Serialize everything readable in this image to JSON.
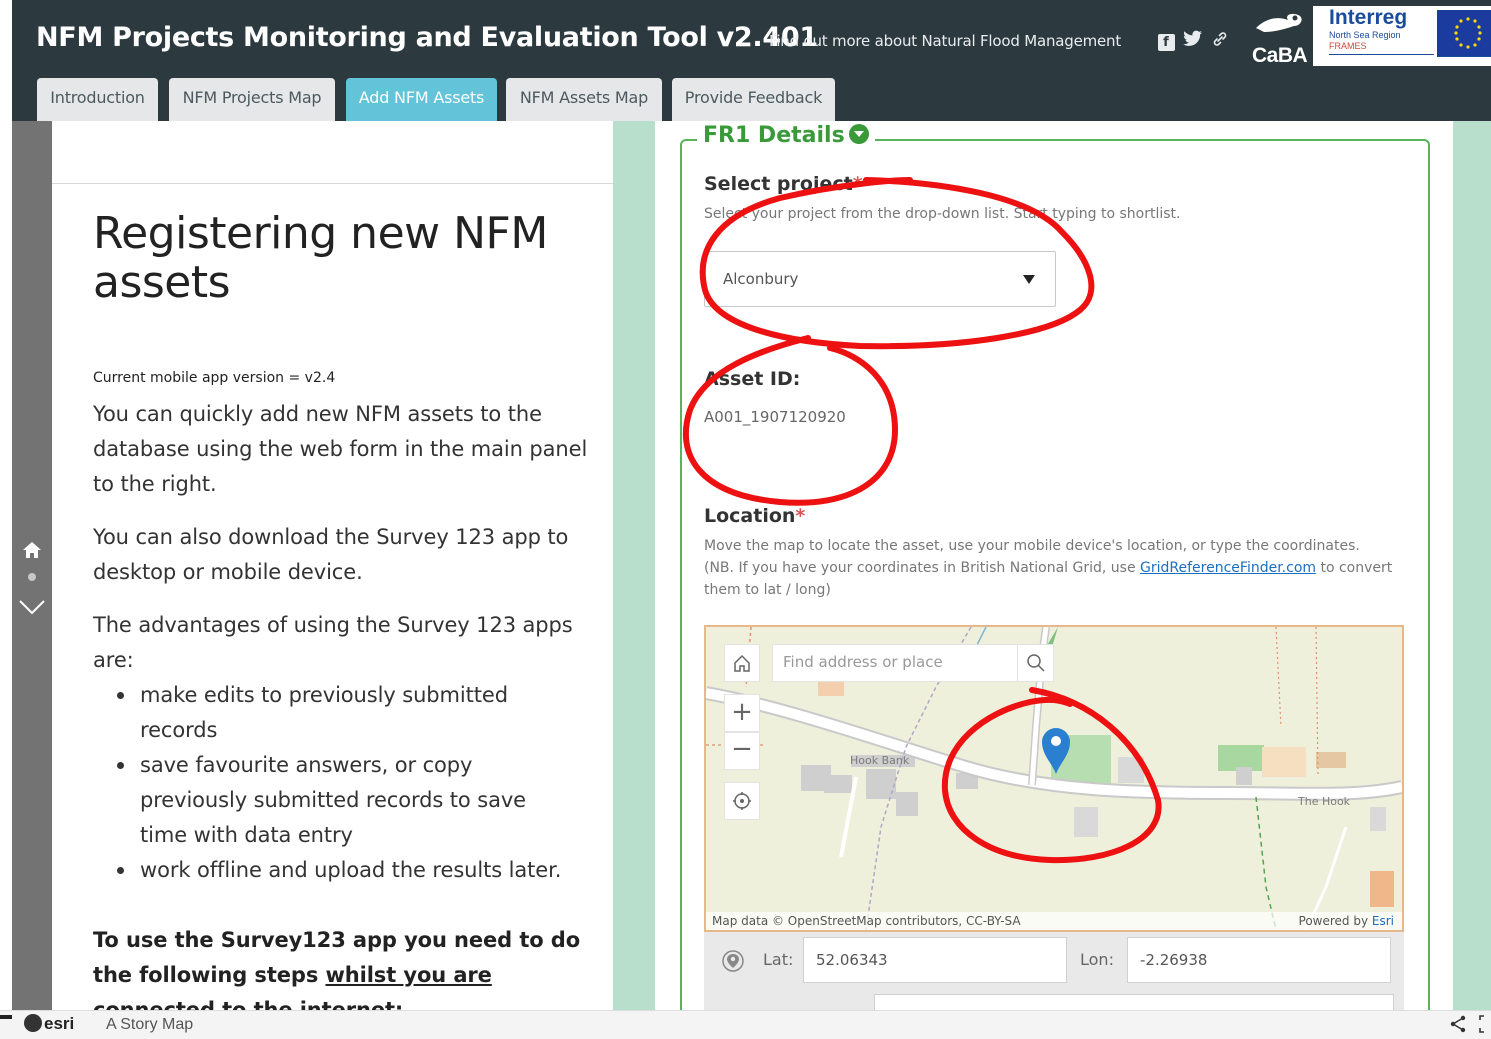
{
  "header": {
    "title": "NFM Projects Monitoring and Evaluation Tool v2.401",
    "more_link": "Find out more about Natural Flood Management",
    "logos": {
      "caba": "CaBA",
      "interreg": "Interreg",
      "interreg_sub": "North Sea Region",
      "interreg_project": "FRAMES"
    },
    "icons": [
      "facebook-icon",
      "twitter-icon",
      "link-icon"
    ],
    "colors": {
      "header_bg": "#2c3a3f",
      "active_tab": "#62c3d9",
      "accent_green": "#3a9a3a"
    }
  },
  "tabs": [
    {
      "label": "Introduction",
      "active": false
    },
    {
      "label": "NFM Projects Map",
      "active": false
    },
    {
      "label": "Add NFM Assets",
      "active": true
    },
    {
      "label": "NFM Assets Map",
      "active": false
    },
    {
      "label": "Provide Feedback",
      "active": false
    }
  ],
  "sidebar_nav": {
    "icons": [
      "home-icon",
      "dot-icon",
      "chevron-down-icon"
    ]
  },
  "narrative": {
    "title": "Registering new NFM assets",
    "version": "Current mobile app version = v2.4",
    "p1": "You can quickly add new NFM assets to the database using the web form in the main panel to the right.",
    "p2": "You can also download the Survey 123 app to desktop or mobile device.",
    "p3": "The advantages of using the Survey 123 apps are:",
    "bullets": [
      "make edits to previously submitted records",
      "save favourite answers, or copy previously submitted records to save time with data entry",
      "work offline and upload the results later."
    ],
    "p4_start": "To use the Survey123 app you need to do the following steps ",
    "p4_underlined": "whilst you are",
    "p4_cut": "connected to the internet:"
  },
  "form": {
    "section_title": "FR1 Details",
    "project": {
      "label": "Select project",
      "required_mark": "*",
      "hint": "Select your project from the drop-down list. Start typing to shortlist.",
      "value": "Alconbury"
    },
    "asset": {
      "label": "Asset ID:",
      "value": "A001_1907120920"
    },
    "location": {
      "label": "Location",
      "required_mark": "*",
      "hint_1": "Move the map to locate the asset, use your mobile device's location, or type the coordinates.",
      "hint_2_start": "(NB. If you have your coordinates in British National Grid, use ",
      "hint_link": "GridReferenceFinder.com",
      "hint_2_end": " to convert them to lat / long)"
    },
    "map": {
      "search_placeholder": "Find address or place",
      "zoom_in": "+",
      "zoom_out": "−",
      "labels": {
        "hook_bank": "Hook Bank",
        "the_hook": "The Hook"
      },
      "attribution": "Map data © OpenStreetMap contributors, CC-BY-SA",
      "powered_by": "Powered by ",
      "powered_link": "Esri"
    },
    "coords": {
      "lat_label": "Lat:",
      "lat_value": "52.06343",
      "lon_label": "Lon:",
      "lon_value": "-2.26938"
    }
  },
  "footer": {
    "brand": "esri",
    "story_map": "A Story Map",
    "icons": [
      "share-icon",
      "expand-icon"
    ]
  }
}
